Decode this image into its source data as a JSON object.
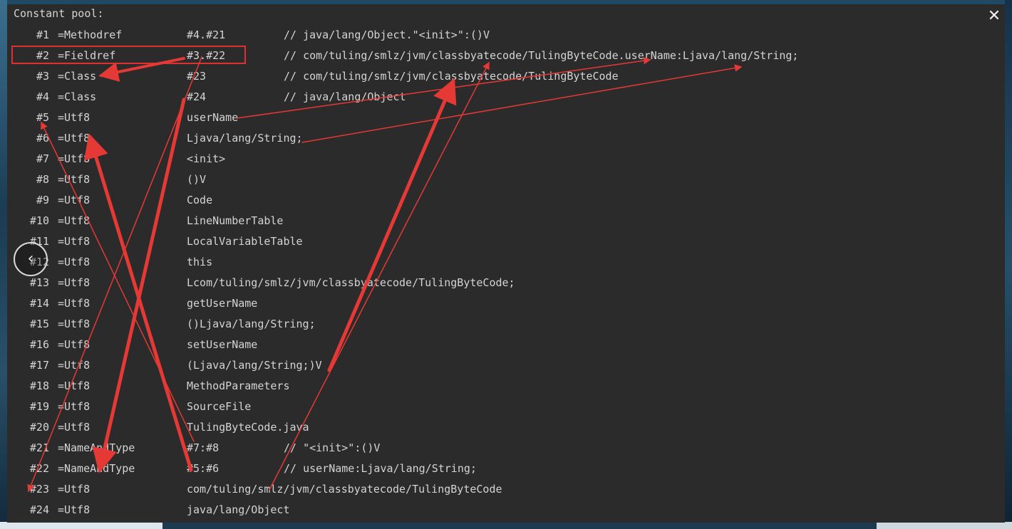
{
  "viewer": {
    "close_glyph": "✕",
    "prev_glyph": "‹"
  },
  "constant_pool": {
    "heading": "Constant pool:",
    "entries": [
      {
        "index": "#1",
        "type": "Methodref",
        "value": "#4.#21",
        "comment": "// java/lang/Object.\"<init>\":()V"
      },
      {
        "index": "#2",
        "type": "Fieldref",
        "value": "#3.#22",
        "comment": "// com/tuling/smlz/jvm/classbyatecode/TulingByteCode.userName:Ljava/lang/String;"
      },
      {
        "index": "#3",
        "type": "Class",
        "value": "#23",
        "comment": "// com/tuling/smlz/jvm/classbyatecode/TulingByteCode"
      },
      {
        "index": "#4",
        "type": "Class",
        "value": "#24",
        "comment": "// java/lang/Object"
      },
      {
        "index": "#5",
        "type": "Utf8",
        "value": "userName",
        "comment": ""
      },
      {
        "index": "#6",
        "type": "Utf8",
        "value": "Ljava/lang/String;",
        "comment": ""
      },
      {
        "index": "#7",
        "type": "Utf8",
        "value": "<init>",
        "comment": ""
      },
      {
        "index": "#8",
        "type": "Utf8",
        "value": "()V",
        "comment": ""
      },
      {
        "index": "#9",
        "type": "Utf8",
        "value": "Code",
        "comment": ""
      },
      {
        "index": "#10",
        "type": "Utf8",
        "value": "LineNumberTable",
        "comment": ""
      },
      {
        "index": "#11",
        "type": "Utf8",
        "value": "LocalVariableTable",
        "comment": ""
      },
      {
        "index": "#12",
        "type": "Utf8",
        "value": "this",
        "comment": ""
      },
      {
        "index": "#13",
        "type": "Utf8",
        "value": "Lcom/tuling/smlz/jvm/classbyatecode/TulingByteCode;",
        "comment": ""
      },
      {
        "index": "#14",
        "type": "Utf8",
        "value": "getUserName",
        "comment": ""
      },
      {
        "index": "#15",
        "type": "Utf8",
        "value": "()Ljava/lang/String;",
        "comment": ""
      },
      {
        "index": "#16",
        "type": "Utf8",
        "value": "setUserName",
        "comment": ""
      },
      {
        "index": "#17",
        "type": "Utf8",
        "value": "(Ljava/lang/String;)V",
        "comment": ""
      },
      {
        "index": "#18",
        "type": "Utf8",
        "value": "MethodParameters",
        "comment": ""
      },
      {
        "index": "#19",
        "type": "Utf8",
        "value": "SourceFile",
        "comment": ""
      },
      {
        "index": "#20",
        "type": "Utf8",
        "value": "TulingByteCode.java",
        "comment": ""
      },
      {
        "index": "#21",
        "type": "NameAndType",
        "value": "#7:#8",
        "comment": "// \"<init>\":()V"
      },
      {
        "index": "#22",
        "type": "NameAndType",
        "value": "#5:#6",
        "comment": "// userName:Ljava/lang/String;"
      },
      {
        "index": "#23",
        "type": "Utf8",
        "value": "com/tuling/smlz/jvm/classbyatecode/TulingByteCode",
        "comment": ""
      },
      {
        "index": "#24",
        "type": "Utf8",
        "value": "java/lang/Object",
        "comment": ""
      }
    ]
  },
  "annotation": {
    "color": "#e53935"
  }
}
